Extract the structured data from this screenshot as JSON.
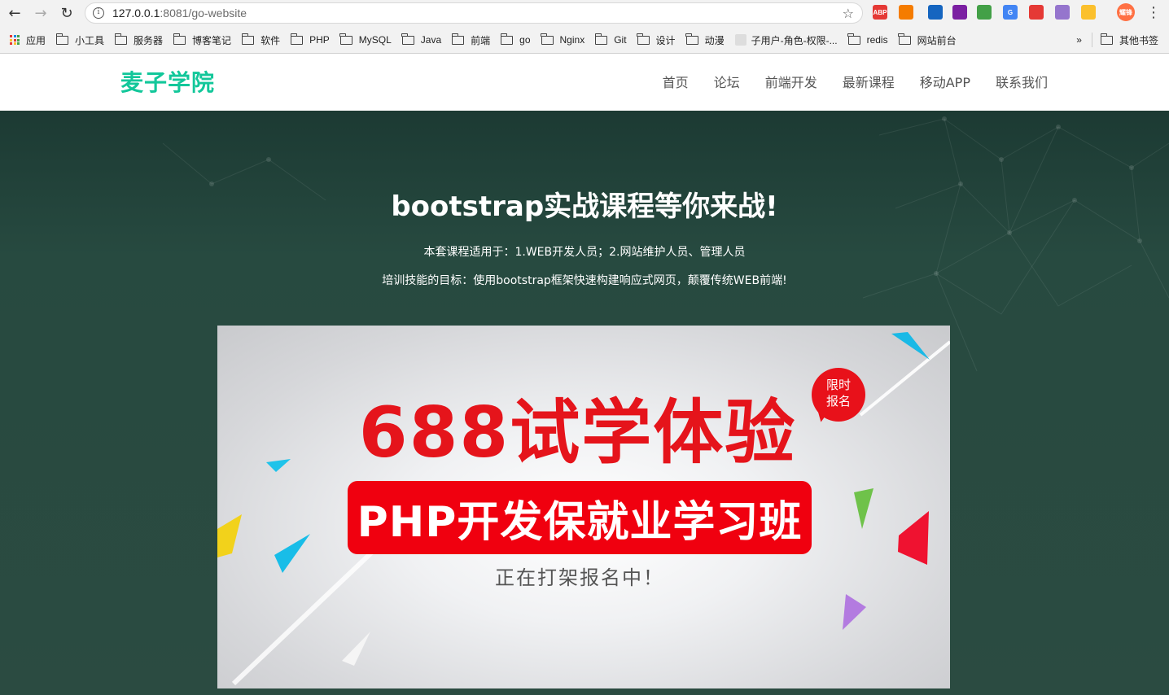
{
  "browser": {
    "url_host": "127.0.0.1",
    "url_rest": ":8081/go-website",
    "extensions": [
      {
        "name": "abp-extension-icon",
        "label": "ABP",
        "color": "#e53935"
      },
      {
        "name": "arrow-extension-icon",
        "label": "",
        "color": "#f57c00"
      },
      {
        "name": "pen-extension-icon",
        "label": "",
        "color": "#1565c0"
      },
      {
        "name": "bracket-extension-icon",
        "label": "",
        "color": "#7b1fa2"
      },
      {
        "name": "chrome-extension-icon",
        "label": "",
        "color": "#43a047"
      },
      {
        "name": "translate-extension-icon",
        "label": "G",
        "color": "#4285f4"
      },
      {
        "name": "image-extension-icon",
        "label": "",
        "color": "#e53935"
      },
      {
        "name": "gitlab-extension-icon",
        "label": "",
        "color": "#9575cd"
      },
      {
        "name": "color-extension-icon",
        "label": "",
        "color": "#fbc02d"
      },
      {
        "name": "profile-avatar-icon",
        "label": "耀锋",
        "color": "#ff7043"
      }
    ],
    "bookmarks": [
      {
        "label": "应用",
        "type": "apps"
      },
      {
        "label": "小工具",
        "type": "folder"
      },
      {
        "label": "服务器",
        "type": "folder"
      },
      {
        "label": "博客笔记",
        "type": "folder"
      },
      {
        "label": "软件",
        "type": "folder"
      },
      {
        "label": "PHP",
        "type": "folder"
      },
      {
        "label": "MySQL",
        "type": "folder"
      },
      {
        "label": "Java",
        "type": "folder"
      },
      {
        "label": "前端",
        "type": "folder"
      },
      {
        "label": "go",
        "type": "folder"
      },
      {
        "label": "Nginx",
        "type": "folder"
      },
      {
        "label": "Git",
        "type": "folder"
      },
      {
        "label": "设计",
        "type": "folder"
      },
      {
        "label": "动漫",
        "type": "folder"
      },
      {
        "label": "子用户-角色-权限-...",
        "type": "page"
      },
      {
        "label": "redis",
        "type": "folder"
      },
      {
        "label": "网站前台",
        "type": "folder"
      }
    ],
    "more_bookmarks": "»",
    "other_bookmarks": "其他书签"
  },
  "site": {
    "logo": "麦子学院",
    "nav": [
      "首页",
      "论坛",
      "前端开发",
      "最新课程",
      "移动APP",
      "联系我们"
    ]
  },
  "hero": {
    "title": "bootstrap实战课程等你来战!",
    "line1": "本套课程适用于：1.WEB开发人员；2.网站维护人员、管理人员",
    "line2": "培训技能的目标：使用bootstrap框架快速构建响应式网页，颠覆传统WEB前端!"
  },
  "banner": {
    "headline": "688试学体验",
    "bar_text": "PHP开发保就业学习班",
    "subtitle": "正在打架报名中！",
    "badge_line1": "限时",
    "badge_line2": "报名",
    "headline_color": "#e5141b",
    "bar_color": "#f0000f"
  },
  "colors": {
    "logo": "#12c79a",
    "hero_bg": "#2b4b41"
  }
}
